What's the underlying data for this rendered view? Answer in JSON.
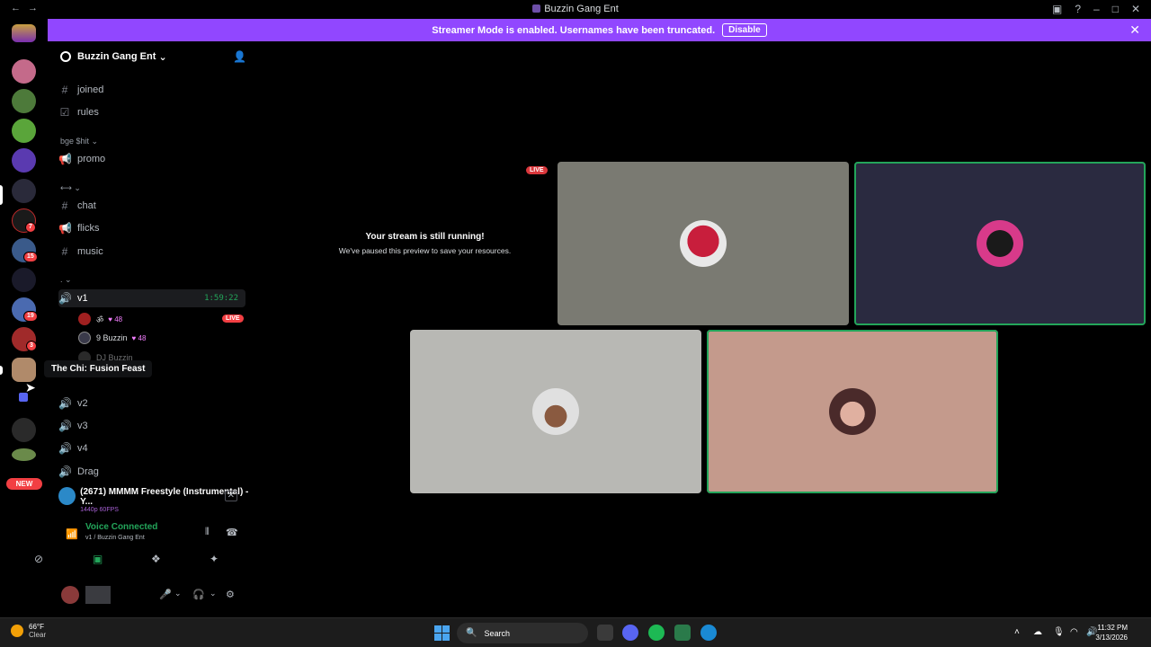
{
  "window": {
    "title": "Buzzin Gang Ent"
  },
  "banner": {
    "text": "Streamer Mode is enabled. Usernames have been truncated.",
    "disable_label": "Disable"
  },
  "server": {
    "name": "Buzzin Gang Ent"
  },
  "channels": [
    {
      "name": "joined",
      "type": "text"
    },
    {
      "name": "rules",
      "type": "rules"
    },
    {
      "category": "bge $hit"
    },
    {
      "name": "promo",
      "type": "announce"
    },
    {
      "category": "⟷"
    },
    {
      "name": "chat",
      "type": "text"
    },
    {
      "name": "flicks",
      "type": "announce"
    },
    {
      "name": "music",
      "type": "text"
    },
    {
      "category": "."
    }
  ],
  "voice_channels": {
    "v1": {
      "name": "v1",
      "timer": "1:59:22"
    },
    "v2": "v2",
    "v3": "v3",
    "v4": "v4",
    "drag": "Drag"
  },
  "voice_users": [
    {
      "name": "ॐ",
      "boost": "48",
      "live": "LIVE"
    },
    {
      "name": "9 Buzzin",
      "boost": "48"
    },
    {
      "name": "DJ Buzzin"
    }
  ],
  "tooltip": "The Chi: Fusion Feast",
  "rail": {
    "badges": [
      "7",
      "15",
      "19",
      "3"
    ],
    "new_label": "NEW"
  },
  "activity": {
    "title": "(2671) MMMM Freestyle (Instrumental) - Y...",
    "quality": "1440p 60FPS"
  },
  "voice": {
    "status": "Voice Connected",
    "channel": "v1 / Buzzin Gang Ent"
  },
  "stage": {
    "live_label": "LIVE",
    "paused_title": "Your stream is still running!",
    "paused_sub": "We've paused this preview to save your resources."
  },
  "taskbar": {
    "temp": "66°F",
    "condition": "Clear",
    "search_placeholder": "Search",
    "time": "11:32 PM",
    "date": "3/13/2026"
  },
  "colors": {
    "banner": "#9147ff",
    "speaking": "#23a55a",
    "live": "#f23f43"
  }
}
